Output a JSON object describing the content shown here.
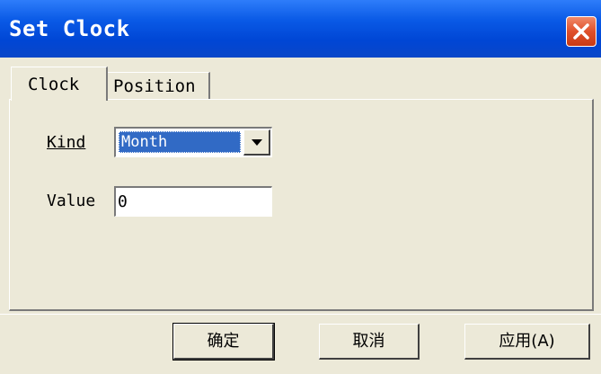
{
  "window": {
    "title": "Set Clock",
    "close_icon": "close-icon",
    "accent": "#0a5ae6",
    "close_color": "#e0502b"
  },
  "tabs": [
    {
      "label": "Clock",
      "active": true
    },
    {
      "label": "Position",
      "active": false
    }
  ],
  "form": {
    "kind_label": "Kind",
    "kind_value": "Month",
    "value_label": "Value",
    "value_value": "0"
  },
  "buttons": {
    "ok": "确定",
    "cancel": "取消",
    "apply": "应用(A)"
  },
  "selection_color": "#316ac5"
}
